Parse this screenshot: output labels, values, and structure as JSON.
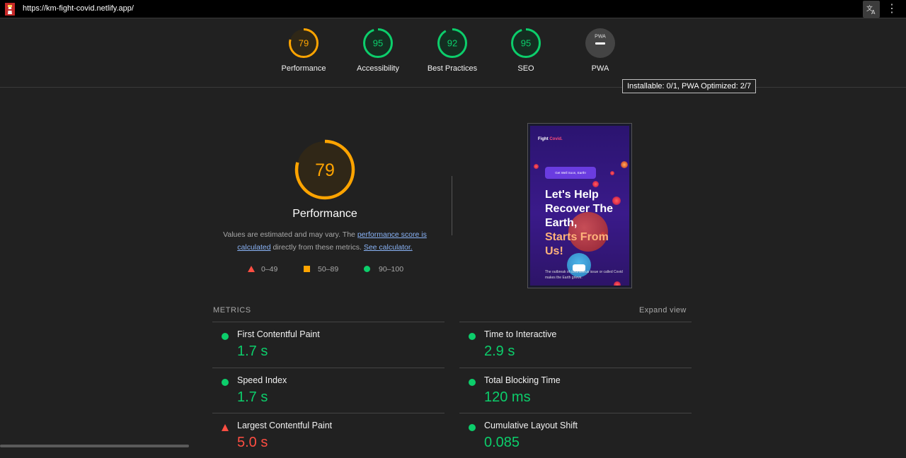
{
  "browser": {
    "url": "https://km-fight-covid.netlify.app/",
    "favicon_icon": "lighthouse-icon",
    "translate_icon": "translate-icon",
    "menu_icon": "kebab-menu-icon"
  },
  "categories": [
    {
      "label": "Performance",
      "score": "79",
      "value": 0.79,
      "color": "#ffa400"
    },
    {
      "label": "Accessibility",
      "score": "95",
      "value": 0.95,
      "color": "#0cce6b"
    },
    {
      "label": "Best Practices",
      "score": "92",
      "value": 0.92,
      "color": "#0cce6b"
    },
    {
      "label": "SEO",
      "score": "95",
      "value": 0.95,
      "color": "#0cce6b"
    },
    {
      "label": "PWA",
      "score": "",
      "badge": "PWA",
      "color": "#9e9e9e"
    }
  ],
  "tooltip": "Installable: 0/1, PWA Optimized: 2/7",
  "performance": {
    "score": "79",
    "value": 0.79,
    "title": "Performance",
    "desc_pre": "Values are estimated and may vary. The ",
    "desc_link1": "performance score is calculated",
    "desc_mid": " directly from these metrics. ",
    "desc_link2": "See calculator.",
    "legend": [
      {
        "shape": "triangle",
        "range": "0–49",
        "color": "#ff4e42"
      },
      {
        "shape": "square",
        "range": "50–89",
        "color": "#ffa400"
      },
      {
        "shape": "circle",
        "range": "90–100",
        "color": "#0cce6b"
      }
    ]
  },
  "thumbnail": {
    "brand": "Fight",
    "brand_accent": "Covid.",
    "pill": "Get Well Soon, Earth!",
    "heading_line1": "Let's Help",
    "heading_line2": "Recover The",
    "heading_line3": "Earth,",
    "heading_hl1": "Starts From",
    "heading_hl2": "Us!",
    "para": "The outbreak of coronavirus issue or called Covid makes the Earth grieve."
  },
  "metrics": {
    "heading": "METRICS",
    "expand_label": "Expand view",
    "items": [
      {
        "name": "First Contentful Paint",
        "value": "1.7 s",
        "status": "good"
      },
      {
        "name": "Time to Interactive",
        "value": "2.9 s",
        "status": "good"
      },
      {
        "name": "Speed Index",
        "value": "1.7 s",
        "status": "good"
      },
      {
        "name": "Total Blocking Time",
        "value": "120 ms",
        "status": "good"
      },
      {
        "name": "Largest Contentful Paint",
        "value": "5.0 s",
        "status": "poor"
      },
      {
        "name": "Cumulative Layout Shift",
        "value": "0.085",
        "status": "good"
      }
    ]
  }
}
